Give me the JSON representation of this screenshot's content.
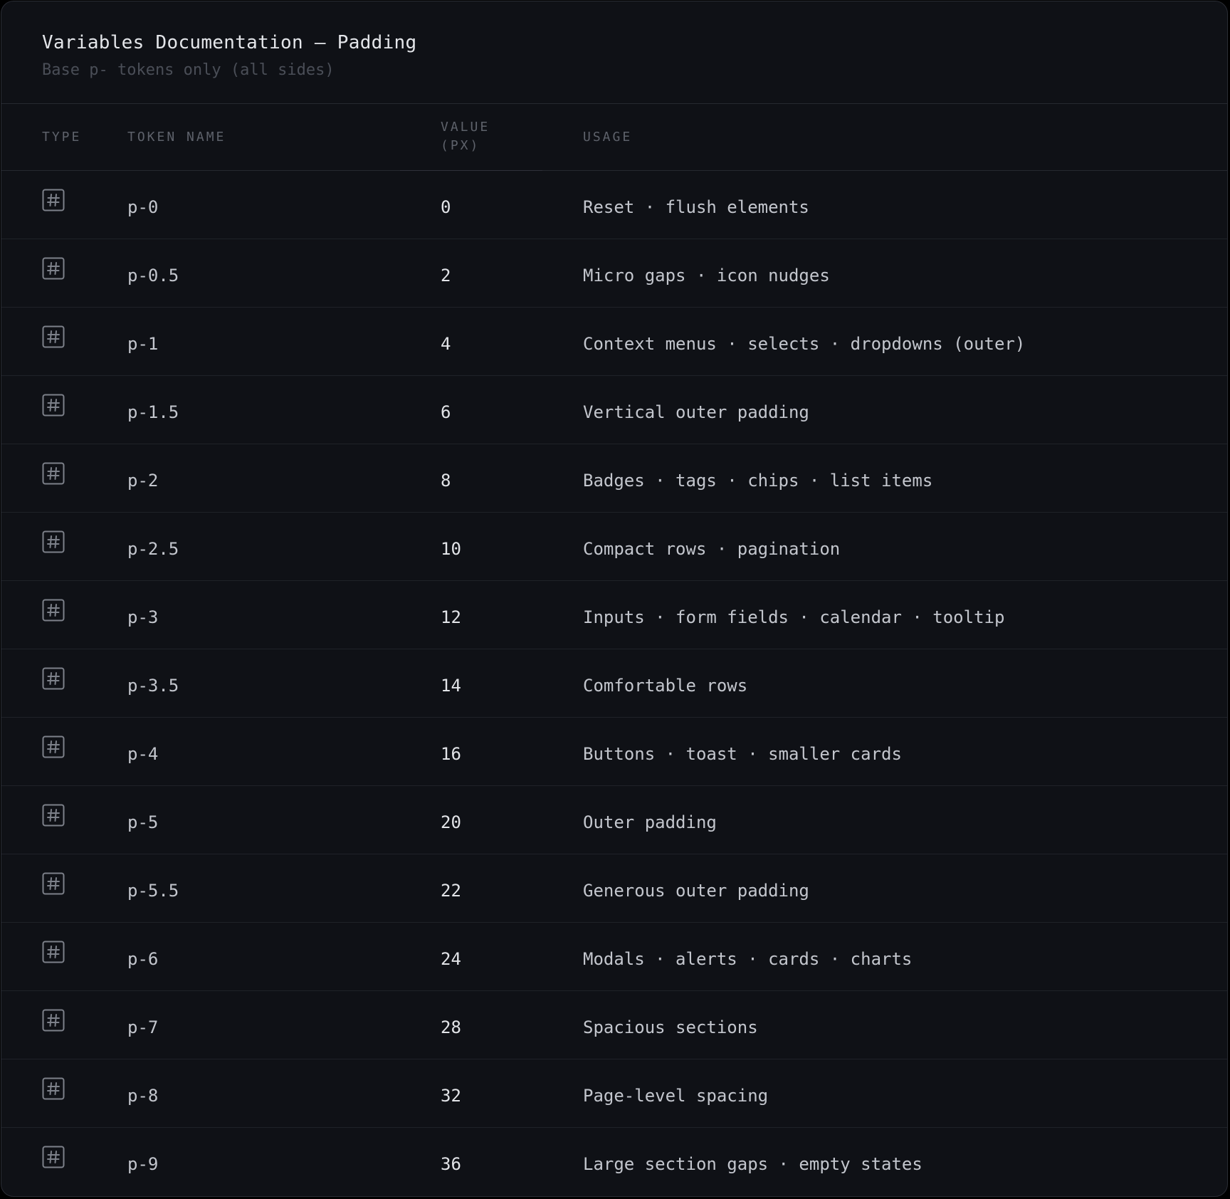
{
  "header": {
    "title": "Variables Documentation — Padding",
    "subtitle": "Base p- tokens only (all sides)"
  },
  "columns": {
    "type": "TYPE",
    "name": "TOKEN NAME",
    "value_line1": "VALUE",
    "value_line2": "(PX)",
    "usage": "USAGE"
  },
  "type_icon": "hash-number-icon",
  "colors": {
    "background": "#0f1116",
    "border": "#2a2d35",
    "icon": "#7d818a"
  },
  "rows": [
    {
      "name": "p-0",
      "value": "0",
      "usage": "Reset · flush elements"
    },
    {
      "name": "p-0.5",
      "value": "2",
      "usage": "Micro gaps · icon nudges"
    },
    {
      "name": "p-1",
      "value": "4",
      "usage": "Context menus · selects · dropdowns (outer)"
    },
    {
      "name": "p-1.5",
      "value": "6",
      "usage": "Vertical outer padding"
    },
    {
      "name": "p-2",
      "value": "8",
      "usage": "Badges · tags · chips · list items"
    },
    {
      "name": "p-2.5",
      "value": "10",
      "usage": "Compact rows · pagination"
    },
    {
      "name": "p-3",
      "value": "12",
      "usage": "Inputs · form fields · calendar · tooltip"
    },
    {
      "name": "p-3.5",
      "value": "14",
      "usage": "Comfortable rows"
    },
    {
      "name": "p-4",
      "value": "16",
      "usage": "Buttons · toast · smaller cards"
    },
    {
      "name": "p-5",
      "value": "20",
      "usage": "Outer padding"
    },
    {
      "name": "p-5.5",
      "value": "22",
      "usage": "Generous outer padding"
    },
    {
      "name": "p-6",
      "value": "24",
      "usage": "Modals · alerts · cards · charts"
    },
    {
      "name": "p-7",
      "value": "28",
      "usage": "Spacious sections"
    },
    {
      "name": "p-8",
      "value": "32",
      "usage": "Page-level spacing"
    },
    {
      "name": "p-9",
      "value": "36",
      "usage": "Large section gaps · empty states"
    }
  ]
}
